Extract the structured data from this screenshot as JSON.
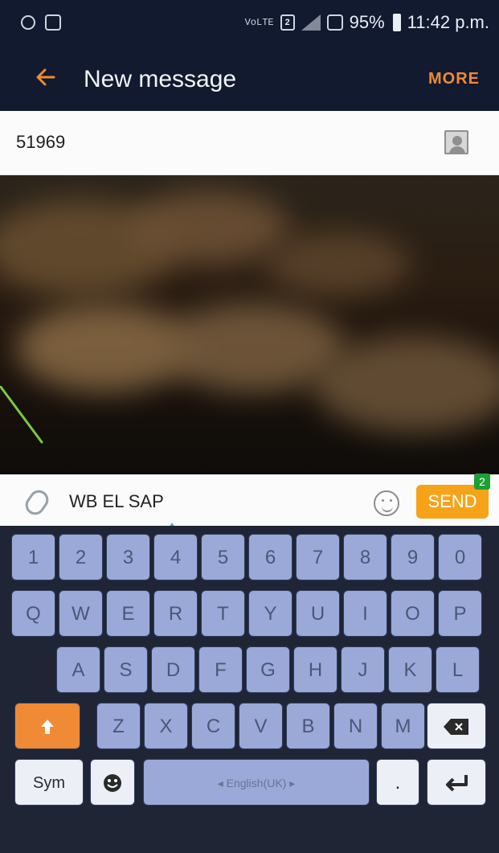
{
  "status_bar": {
    "volte_text": "VoLTE",
    "sim_indicator": "2",
    "battery_text": "95%",
    "time": "11:42 p.m."
  },
  "header": {
    "back_icon": "arrow-left-icon",
    "title": "New message",
    "more_label": "MORE"
  },
  "recipient": {
    "value": "51969",
    "contact_picker_icon": "contact-picker-icon"
  },
  "compose": {
    "attachment_icon": "paperclip-icon",
    "text": "WB EL SAP",
    "emoji_icon": "smiley-icon",
    "send_label": "SEND",
    "send_badge": "2"
  },
  "keyboard": {
    "number_row": [
      "1",
      "2",
      "3",
      "4",
      "5",
      "6",
      "7",
      "8",
      "9",
      "0"
    ],
    "qwerty_row": [
      "Q",
      "W",
      "E",
      "R",
      "T",
      "Y",
      "U",
      "I",
      "O",
      "P"
    ],
    "asdf_row": [
      "A",
      "S",
      "D",
      "F",
      "G",
      "H",
      "J",
      "K",
      "L"
    ],
    "zxcv_row": [
      "Z",
      "X",
      "C",
      "V",
      "B",
      "N",
      "M"
    ],
    "shift_icon": "shift-arrow-icon",
    "backspace_icon": "backspace-icon",
    "sym_label": "Sym",
    "emoji_key_icon": "emoji-key-icon",
    "space_label": "◂ English(UK) ▸",
    "period_label": ".",
    "enter_icon": "enter-icon"
  },
  "colors": {
    "accent_orange": "#f08a34",
    "send_orange": "#f7a31a",
    "badge_green": "#1e9f36",
    "key_blue": "#9aa9d8",
    "dark_bg": "#111a2e",
    "annotation_green": "#7ac943"
  }
}
